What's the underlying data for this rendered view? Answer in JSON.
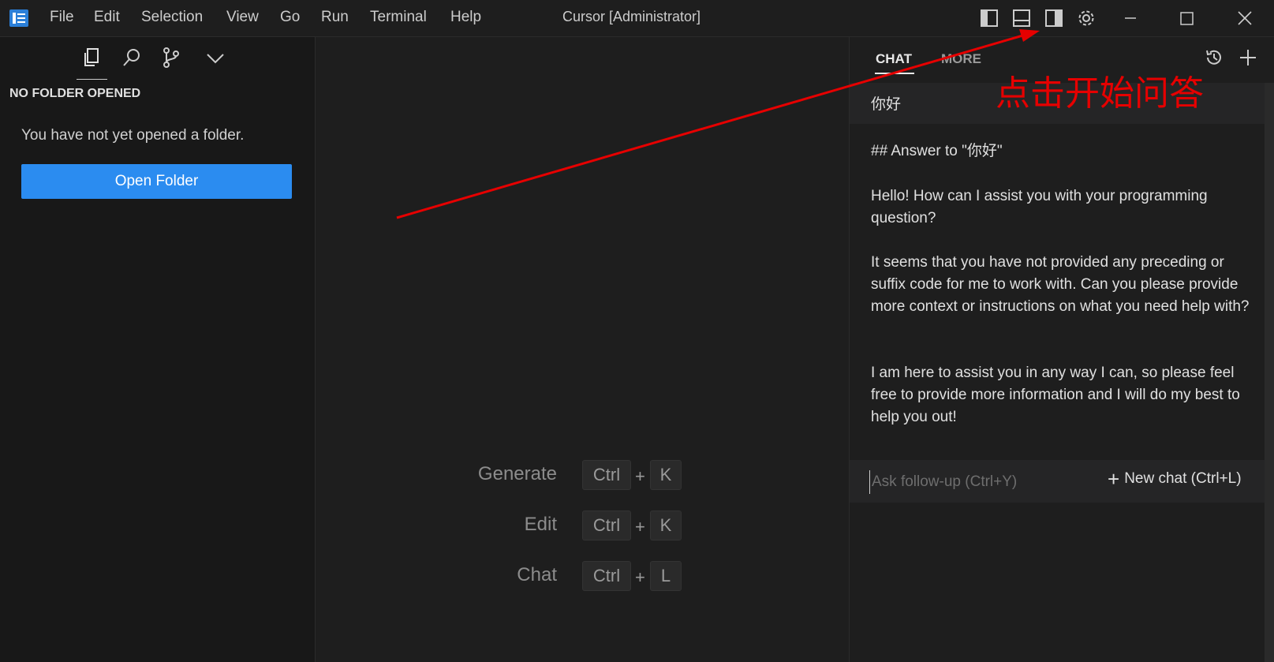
{
  "app": {
    "title": "Cursor [Administrator]"
  },
  "menu": {
    "items": [
      "File",
      "Edit",
      "Selection",
      "View",
      "Go",
      "Run",
      "Terminal",
      "Help"
    ]
  },
  "titlebar_icons": [
    "toggle-primary-sidebar-icon",
    "toggle-panel-icon",
    "toggle-secondary-sidebar-icon",
    "settings-gear-icon"
  ],
  "window_controls": [
    "minimize-icon",
    "maximize-icon",
    "close-icon"
  ],
  "sidebar": {
    "tabs": [
      "explorer-icon",
      "search-icon",
      "source-control-icon",
      "chevron-down-icon"
    ],
    "active_tab": "explorer-icon",
    "section_title": "NO FOLDER OPENED",
    "message": "You have not yet opened a folder.",
    "open_folder_label": "Open Folder"
  },
  "editor": {
    "shortcuts": [
      {
        "label": "Generate",
        "ctrl": "Ctrl",
        "plus": "+",
        "key": "K"
      },
      {
        "label": "Edit",
        "ctrl": "Ctrl",
        "plus": "+",
        "key": "K"
      },
      {
        "label": "Chat",
        "ctrl": "Ctrl",
        "plus": "+",
        "key": "L"
      }
    ]
  },
  "chat": {
    "tabs": {
      "chat": "CHAT",
      "more": "MORE"
    },
    "active_tab": "CHAT",
    "user_message": "你好",
    "answer": {
      "heading": "## Answer to \"你好\"",
      "p1": "Hello! How can I assist you with your programming question?",
      "p2": "It seems that you have not provided any preceding or suffix code for me to work with. Can you please provide more context or instructions on what you need help with?",
      "p3": "I am here to assist you in any way I can, so please feel free to provide more information and I will do my best to help you out!"
    },
    "followup": {
      "placeholder": "Ask follow-up (Ctrl+Y)",
      "value": ""
    },
    "new_chat_label": "New chat (Ctrl+L)"
  },
  "annotation": {
    "text": "点击开始问答",
    "color": "#e60000"
  },
  "colors": {
    "accent": "#2b8cf0",
    "background": "#1e1e1e",
    "sidebar_bg": "#181818",
    "annotation": "#e60000"
  }
}
